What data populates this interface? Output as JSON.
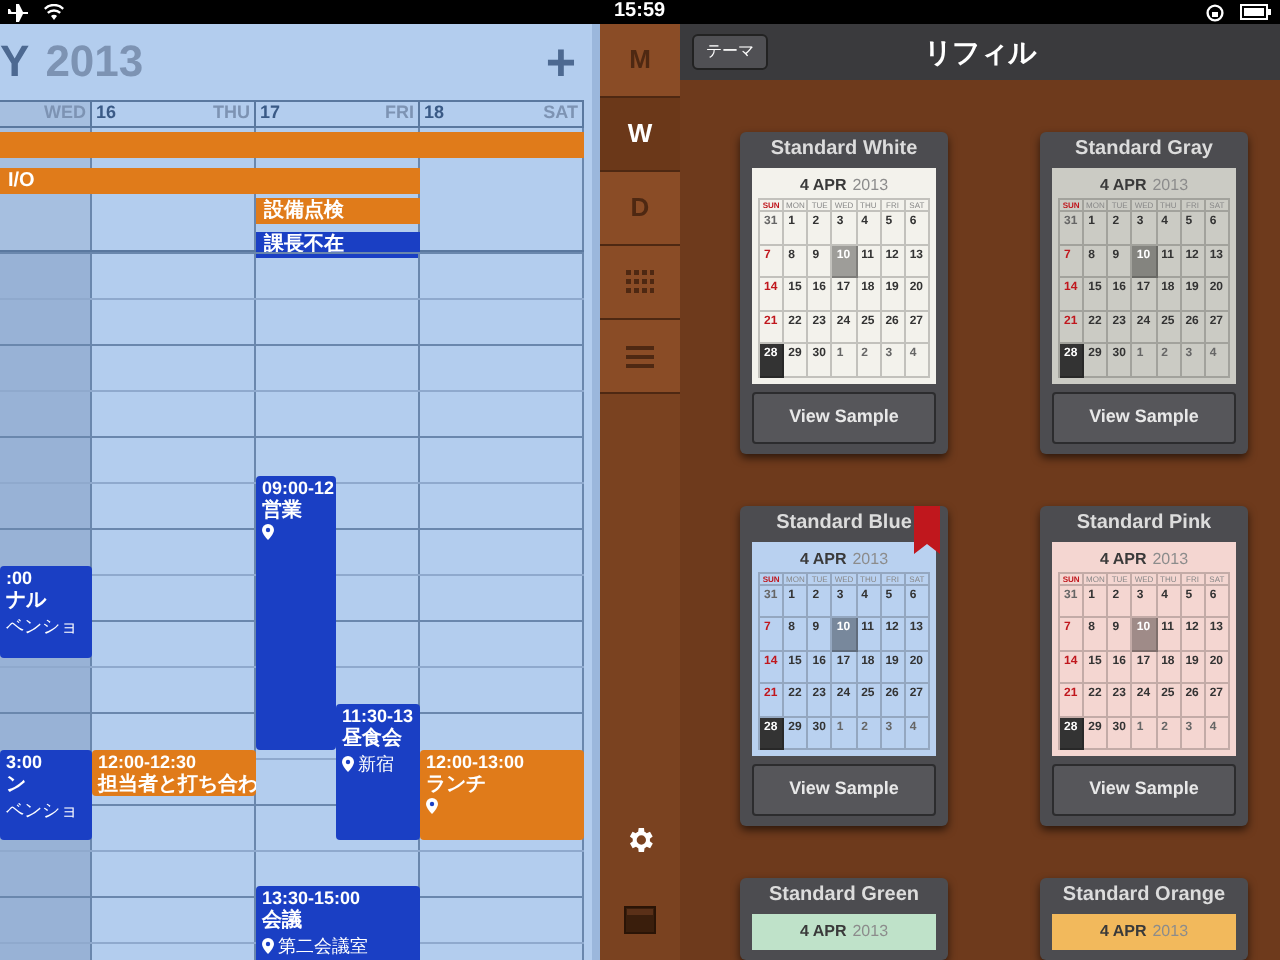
{
  "status_bar": {
    "time": "15:59"
  },
  "calendar": {
    "month": "Y",
    "year": "2013",
    "add": "+",
    "columns": [
      {
        "day": "WED",
        "shaded": true
      },
      {
        "date": "16",
        "day": "THU",
        "shaded": false
      },
      {
        "date": "17",
        "day": "FRI",
        "shaded": false
      },
      {
        "date": "18",
        "day": "SAT",
        "shaded": false
      }
    ],
    "all_day": [
      {
        "color": "#e07b1a"
      },
      {
        "title": "I/O",
        "color": "#e07b1a"
      },
      {
        "title": "設備点検",
        "color": "#e07b1a"
      },
      {
        "title": "課長不在",
        "color": "#1a3fc4"
      }
    ],
    "events": [
      {
        "time": "09:00-12",
        "title": "営業",
        "pin": true,
        "color": "#1a3fc4"
      },
      {
        "time": ":00",
        "title": "ナル",
        "place": "ベンショ",
        "pin": false,
        "color": "#1a3fc4"
      },
      {
        "time": "3:00",
        "title": "ン",
        "place": "ベンショ",
        "pin": false,
        "color": "#1a3fc4"
      },
      {
        "time": "12:00-12:30",
        "title": "担当者と打ち合わ",
        "pin": false,
        "color": "#e07b1a"
      },
      {
        "time": "11:30-13",
        "title": "昼食会",
        "place": "新宿",
        "pin": true,
        "color": "#1a3fc4"
      },
      {
        "time": "12:00-13:00",
        "title": "ランチ",
        "pin": true,
        "color": "#e07b1a"
      },
      {
        "time": "13:30-15:00",
        "title": "会議",
        "place": "第二会議室",
        "pin": true,
        "color": "#1a3fc4"
      }
    ]
  },
  "view_nav": [
    {
      "label": "M",
      "selected": false
    },
    {
      "label": "W",
      "selected": true
    },
    {
      "label": "D",
      "selected": false
    }
  ],
  "refill": {
    "back": "テーマ",
    "title": "リフィル",
    "cards": [
      {
        "name": "Standard White",
        "color": "#f3f2ec",
        "selected": false,
        "day": "4 APR",
        "year": "2013",
        "weekdays": [
          "SUN",
          "MON",
          "TUE",
          "WED",
          "THU",
          "FRI",
          "SAT"
        ],
        "days": [
          "31",
          "1",
          "2",
          "3",
          "4",
          "5",
          "6",
          "7",
          "8",
          "9",
          "10",
          "11",
          "12",
          "13",
          "14",
          "15",
          "16",
          "17",
          "18",
          "19",
          "20",
          "21",
          "22",
          "23",
          "24",
          "25",
          "26",
          "27",
          "28",
          "29",
          "30",
          "1",
          "2",
          "3",
          "4"
        ],
        "button": "View Sample"
      },
      {
        "name": "Standard Gray",
        "color": "#cbcbc4",
        "selected": false,
        "day": "4 APR",
        "year": "2013",
        "weekdays": [
          "SUN",
          "MON",
          "TUE",
          "WED",
          "THU",
          "FRI",
          "SAT"
        ],
        "days": [
          "31",
          "1",
          "2",
          "3",
          "4",
          "5",
          "6",
          "7",
          "8",
          "9",
          "10",
          "11",
          "12",
          "13",
          "14",
          "15",
          "16",
          "17",
          "18",
          "19",
          "20",
          "21",
          "22",
          "23",
          "24",
          "25",
          "26",
          "27",
          "28",
          "29",
          "30",
          "1",
          "2",
          "3",
          "4"
        ],
        "button": "View Sample"
      },
      {
        "name": "Standard Blue",
        "color": "#b9d1f0",
        "selected": true,
        "day": "4 APR",
        "year": "2013",
        "weekdays": [
          "SUN",
          "MON",
          "TUE",
          "WED",
          "THU",
          "FRI",
          "SAT"
        ],
        "days": [
          "31",
          "1",
          "2",
          "3",
          "4",
          "5",
          "6",
          "7",
          "8",
          "9",
          "10",
          "11",
          "12",
          "13",
          "14",
          "15",
          "16",
          "17",
          "18",
          "19",
          "20",
          "21",
          "22",
          "23",
          "24",
          "25",
          "26",
          "27",
          "28",
          "29",
          "30",
          "1",
          "2",
          "3",
          "4"
        ],
        "button": "View Sample"
      },
      {
        "name": "Standard Pink",
        "color": "#f4d6d1",
        "selected": false,
        "day": "4 APR",
        "year": "2013",
        "weekdays": [
          "SUN",
          "MON",
          "TUE",
          "WED",
          "THU",
          "FRI",
          "SAT"
        ],
        "days": [
          "31",
          "1",
          "2",
          "3",
          "4",
          "5",
          "6",
          "7",
          "8",
          "9",
          "10",
          "11",
          "12",
          "13",
          "14",
          "15",
          "16",
          "17",
          "18",
          "19",
          "20",
          "21",
          "22",
          "23",
          "24",
          "25",
          "26",
          "27",
          "28",
          "29",
          "30",
          "1",
          "2",
          "3",
          "4"
        ],
        "button": "View Sample"
      },
      {
        "name": "Standard Green",
        "color": "#bfe2c9",
        "selected": false,
        "day": "4 APR",
        "year": "2013"
      },
      {
        "name": "Standard Orange",
        "color": "#f2b95c",
        "selected": false,
        "day": "4 APR",
        "year": "2013"
      }
    ]
  }
}
